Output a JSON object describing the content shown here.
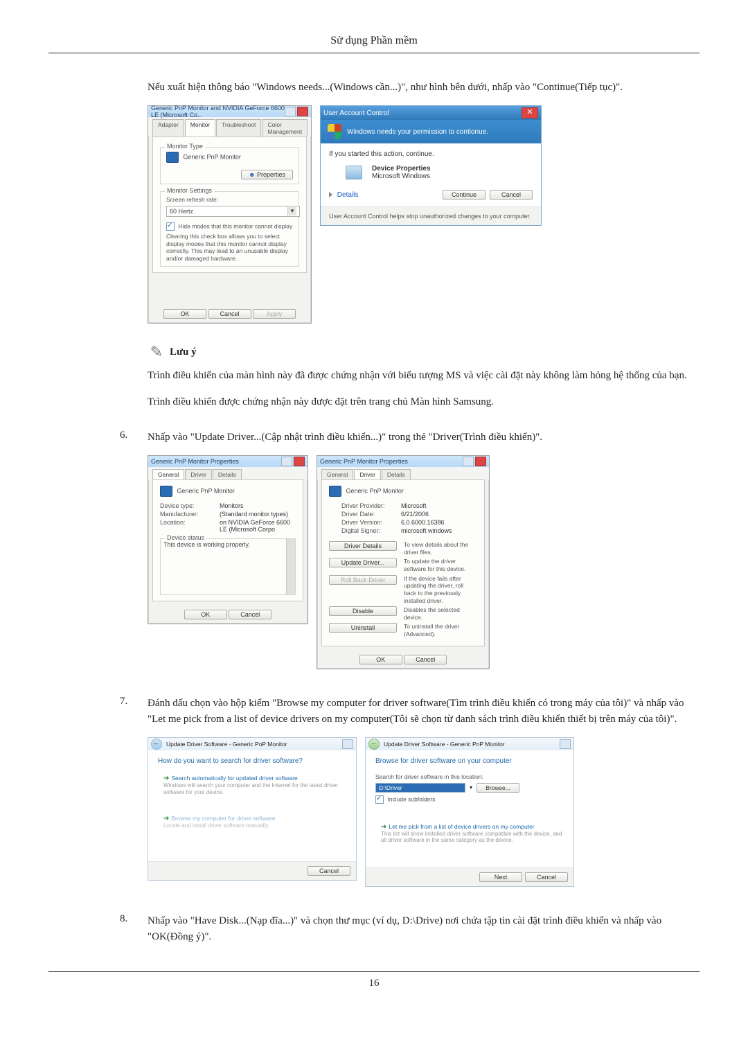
{
  "page": {
    "header": "Sử dụng Phần mềm",
    "number": "16"
  },
  "intro": {
    "p1": "Nếu xuất hiện thông báo \"Windows needs...(Windows cần...)\", như hình bên dưới, nhấp vào \"Continue(Tiếp tục)\"."
  },
  "monitor_dialog": {
    "title": "Generic PnP Monitor and NVIDIA GeForce 6600 LE (Microsoft Co...",
    "tabs": {
      "adapter": "Adapter",
      "monitor": "Monitor",
      "troubleshoot": "Troubleshoot",
      "color": "Color Management"
    },
    "group_type": "Monitor Type",
    "monitor_name": "Generic PnP Monitor",
    "properties_btn": "Properties",
    "group_settings": "Monitor Settings",
    "refresh_label": "Screen refresh rate:",
    "refresh_value": "60 Hertz",
    "hide_chk": "Hide modes that this monitor cannot display",
    "hide_desc": "Clearing this check box allows you to select display modes that this monitor cannot display correctly. This may lead to an unusable display and/or damaged hardware.",
    "ok": "OK",
    "cancel": "Cancel",
    "apply": "Apply"
  },
  "uac": {
    "titlebar": "User Account Control",
    "headline": "Windows needs your permission to contionue.",
    "started": "If you started this action, continue.",
    "prog_name": "Device Properties",
    "prog_pub": "Microsoft Windows",
    "details": "Details",
    "continue_btn": "Continue",
    "cancel_btn": "Cancel",
    "footer": "User Account Control helps stop unauthorized changes to your computer."
  },
  "note": {
    "title": "Lưu ý",
    "p1": "Trình điều khiển của màn hình này đã được chứng nhận với biểu tượng MS và việc cài đặt này không làm hỏng hệ thống của bạn.",
    "p2": "Trình điều khiển được chứng nhận này được đặt trên trang chủ Màn hình Samsung."
  },
  "step6": {
    "num": "6.",
    "text": "Nhấp vào \"Update Driver...(Cập nhật trình điều khiển...)\" trong thẻ \"Driver(Trình điều khiển)\"."
  },
  "props_general": {
    "title": "Generic PnP Monitor Properties",
    "tabs": {
      "general": "General",
      "driver": "Driver",
      "details": "Details"
    },
    "name": "Generic PnP Monitor",
    "device_type_k": "Device type:",
    "device_type_v": "Monitors",
    "manufacturer_k": "Manufacturer:",
    "manufacturer_v": "(Standard monitor types)",
    "location_k": "Location:",
    "location_v": "on NVIDIA GeForce 6600 LE (Microsoft Corpo",
    "status_group": "Device status",
    "status_text": "This device is working properly.",
    "ok": "OK",
    "cancel": "Cancel"
  },
  "props_driver": {
    "title": "Generic PnP Monitor Properties",
    "tabs": {
      "general": "General",
      "driver": "Driver",
      "details": "Details"
    },
    "name": "Generic PnP Monitor",
    "provider_k": "Driver Provider:",
    "provider_v": "Microsoft",
    "date_k": "Driver Date:",
    "date_v": "6/21/2006",
    "version_k": "Driver Version:",
    "version_v": "6.0.6000.16386",
    "signer_k": "Digital Signer:",
    "signer_v": "microsoft windows",
    "btn_details": "Driver Details",
    "btn_details_d": "To view details about the driver files.",
    "btn_update": "Update Driver...",
    "btn_update_d": "To update the driver software for this device.",
    "btn_rollback": "Roll Back Driver",
    "btn_rollback_d": "If the device fails after updating the driver, roll back to the previously installed driver.",
    "btn_disable": "Disable",
    "btn_disable_d": "Disables the selected device.",
    "btn_uninstall": "Uninstall",
    "btn_uninstall_d": "To uninstall the driver (Advanced).",
    "ok": "OK",
    "cancel": "Cancel"
  },
  "step7": {
    "num": "7.",
    "text": "Đánh dấu chọn vào hộp kiểm \"Browse my computer for driver software(Tìm trình điều khiển có trong máy của tôi)\" và nhấp vào \"Let me pick from a list of device drivers on my computer(Tôi sẽ chọn từ danh sách trình điều khiển thiết bị trên máy của tôi)\"."
  },
  "wiz1": {
    "crumb": "Update Driver Software - Generic PnP Monitor",
    "head": "How do you want to search for driver software?",
    "opt1_t": "Search automatically for updated driver software",
    "opt1_d": "Windows will search your computer and the Internet for the latest driver software for your device.",
    "opt2_t": "Browse my computer for driver software",
    "opt2_d": "Locate and install driver software manually.",
    "cancel": "Cancel"
  },
  "wiz2": {
    "crumb": "Update Driver Software - Generic PnP Monitor",
    "head": "Browse for driver software on your computer",
    "loc_label": "Search for driver software in this location:",
    "path": "D:\\Driver",
    "browse": "Browse...",
    "include": "Include subfolders",
    "opt_t": "Let me pick from a list of device drivers on my computer",
    "opt_d": "This list will show installed driver software compatible with the device, and all driver software in the same category as the device.",
    "next": "Next",
    "cancel": "Cancel"
  },
  "step8": {
    "num": "8.",
    "text": "Nhấp vào \"Have Disk...(Nạp đĩa...)\" và chọn thư mục (ví dụ, D:\\Drive) nơi chứa tập tin cài đặt trình điều khiển và nhấp vào \"OK(Đồng ý)\"."
  }
}
